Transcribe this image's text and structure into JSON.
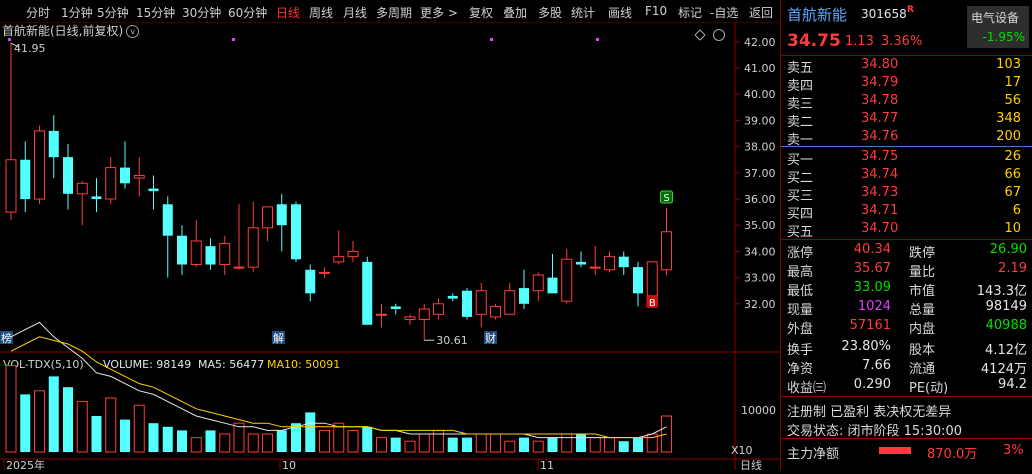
{
  "toolbar": {
    "items": [
      "分时",
      "1分钟",
      "5分钟",
      "15分钟",
      "30分钟",
      "60分钟",
      "日线",
      "周线",
      "月线",
      "多周期",
      "更多 >",
      "复权",
      "叠加",
      "多股",
      "统计",
      "画线",
      "F10",
      "标记",
      "-自选",
      "返回"
    ],
    "active_index": 6
  },
  "chart": {
    "title": "首航新能(日线,前复权)",
    "high_label": "41.95",
    "low_label": "30.61",
    "price_axis": [
      "42.00",
      "41.00",
      "40.00",
      "39.00",
      "38.00",
      "37.00",
      "36.00",
      "35.00",
      "34.00",
      "33.00",
      "32.00"
    ],
    "marker_s": "S",
    "marker_b": "B",
    "event_labels": [
      "榜",
      "解",
      "财"
    ],
    "vol_indicator": {
      "name": "VOL-TDX(5,10)",
      "volume_label": "VOLUME: 98149",
      "ma5_label": "MA5: 56477",
      "ma10_label": "MA10: 50091"
    },
    "vol_axis": [
      "10000",
      "X10"
    ],
    "date_labels": [
      "2025年",
      "10",
      "11"
    ],
    "period_label": "日线"
  },
  "chart_data": {
    "type": "candlestick",
    "title": "首航新能(日线,前复权)",
    "ylim": [
      31.0,
      42.3
    ],
    "candles": [
      {
        "o": 35.5,
        "h": 41.95,
        "l": 35.2,
        "c": 37.5
      },
      {
        "o": 37.5,
        "h": 38.2,
        "l": 35.5,
        "c": 36.0
      },
      {
        "o": 36.0,
        "h": 38.8,
        "l": 35.8,
        "c": 38.6
      },
      {
        "o": 38.6,
        "h": 39.2,
        "l": 36.8,
        "c": 37.6
      },
      {
        "o": 37.6,
        "h": 38.1,
        "l": 35.6,
        "c": 36.2
      },
      {
        "o": 36.2,
        "h": 36.7,
        "l": 35.0,
        "c": 36.6
      },
      {
        "o": 36.1,
        "h": 36.8,
        "l": 35.5,
        "c": 36.0
      },
      {
        "o": 36.0,
        "h": 37.6,
        "l": 35.8,
        "c": 37.2
      },
      {
        "o": 37.2,
        "h": 38.2,
        "l": 36.4,
        "c": 36.6
      },
      {
        "o": 36.8,
        "h": 37.6,
        "l": 36.1,
        "c": 36.9
      },
      {
        "o": 36.4,
        "h": 36.9,
        "l": 35.6,
        "c": 36.3
      },
      {
        "o": 35.8,
        "h": 36.1,
        "l": 33.0,
        "c": 34.6
      },
      {
        "o": 34.6,
        "h": 35.0,
        "l": 33.1,
        "c": 33.5
      },
      {
        "o": 33.5,
        "h": 35.2,
        "l": 33.4,
        "c": 34.4
      },
      {
        "o": 34.2,
        "h": 34.5,
        "l": 33.3,
        "c": 33.5
      },
      {
        "o": 33.5,
        "h": 34.6,
        "l": 33.1,
        "c": 34.3
      },
      {
        "o": 33.4,
        "h": 35.8,
        "l": 33.3,
        "c": 33.4
      },
      {
        "o": 33.4,
        "h": 35.9,
        "l": 33.2,
        "c": 34.9
      },
      {
        "o": 34.9,
        "h": 35.5,
        "l": 34.4,
        "c": 35.7
      },
      {
        "o": 35.8,
        "h": 36.2,
        "l": 34.0,
        "c": 35.0
      },
      {
        "o": 35.8,
        "h": 35.9,
        "l": 33.6,
        "c": 33.7
      },
      {
        "o": 33.3,
        "h": 33.5,
        "l": 32.1,
        "c": 32.4
      },
      {
        "o": 33.2,
        "h": 33.4,
        "l": 33.0,
        "c": 33.2
      },
      {
        "o": 33.6,
        "h": 34.8,
        "l": 33.5,
        "c": 33.8
      },
      {
        "o": 33.8,
        "h": 34.4,
        "l": 33.6,
        "c": 34.0
      },
      {
        "o": 33.6,
        "h": 33.8,
        "l": 31.2,
        "c": 31.2
      },
      {
        "o": 31.6,
        "h": 32.0,
        "l": 31.1,
        "c": 31.6
      },
      {
        "o": 31.9,
        "h": 32.0,
        "l": 31.6,
        "c": 31.8
      },
      {
        "o": 31.4,
        "h": 31.6,
        "l": 31.2,
        "c": 31.5
      },
      {
        "o": 31.4,
        "h": 32.0,
        "l": 30.61,
        "c": 31.8
      },
      {
        "o": 31.6,
        "h": 32.2,
        "l": 31.4,
        "c": 32.0
      },
      {
        "o": 32.3,
        "h": 32.4,
        "l": 32.1,
        "c": 32.2
      },
      {
        "o": 32.5,
        "h": 32.6,
        "l": 31.4,
        "c": 31.5
      },
      {
        "o": 31.6,
        "h": 32.8,
        "l": 31.1,
        "c": 32.5
      },
      {
        "o": 31.5,
        "h": 32.0,
        "l": 31.4,
        "c": 31.9
      },
      {
        "o": 31.6,
        "h": 32.8,
        "l": 31.6,
        "c": 32.5
      },
      {
        "o": 32.6,
        "h": 33.3,
        "l": 31.8,
        "c": 32.0
      },
      {
        "o": 32.5,
        "h": 33.2,
        "l": 32.1,
        "c": 33.1
      },
      {
        "o": 33.0,
        "h": 33.9,
        "l": 32.7,
        "c": 32.4
      },
      {
        "o": 32.1,
        "h": 34.1,
        "l": 32.0,
        "c": 33.7
      },
      {
        "o": 33.6,
        "h": 34.0,
        "l": 33.4,
        "c": 33.5
      },
      {
        "o": 33.4,
        "h": 34.2,
        "l": 33.1,
        "c": 33.4
      },
      {
        "o": 33.3,
        "h": 34.0,
        "l": 33.2,
        "c": 33.8
      },
      {
        "o": 33.8,
        "h": 34.0,
        "l": 33.1,
        "c": 33.4
      },
      {
        "o": 33.4,
        "h": 33.6,
        "l": 31.9,
        "c": 32.4
      },
      {
        "o": 32.3,
        "h": 33.4,
        "l": 32.2,
        "c": 33.6
      },
      {
        "o": 33.3,
        "h": 35.67,
        "l": 33.09,
        "c": 34.75
      }
    ],
    "volumes": [
      24,
      16,
      17,
      21,
      18,
      14,
      10,
      15,
      9,
      13,
      8,
      7,
      6,
      4,
      6,
      5,
      8,
      5,
      5,
      6,
      8,
      11,
      6,
      8,
      6,
      7,
      4,
      4,
      3,
      5,
      6,
      4,
      4,
      5,
      5,
      3,
      4,
      3,
      4,
      5,
      5,
      4,
      4,
      3,
      4,
      5,
      10
    ],
    "ma5": [
      32,
      34,
      36,
      32,
      29,
      26,
      22,
      21,
      19,
      17,
      16,
      14,
      12,
      10,
      9,
      8,
      7,
      7,
      6,
      6,
      7,
      8,
      8,
      7,
      7,
      7,
      6,
      6,
      5,
      5,
      5,
      5,
      5,
      5,
      5,
      5,
      5,
      4,
      4,
      4,
      4,
      4,
      4,
      4,
      4,
      5,
      7
    ],
    "ma10": [
      28,
      30,
      32,
      31,
      30,
      28,
      25,
      23,
      21,
      19,
      18,
      16,
      14,
      12,
      11,
      10,
      9,
      8,
      8,
      7,
      7,
      7,
      7,
      7,
      7,
      7,
      6,
      6,
      6,
      6,
      6,
      6,
      5,
      5,
      5,
      5,
      5,
      5,
      5,
      5,
      5,
      5,
      4,
      4,
      4,
      4,
      5
    ]
  },
  "stock": {
    "name": "首航新能",
    "code": "301658",
    "r_badge": "R",
    "sector": "电气设备",
    "sector_change": "-1.95%",
    "price": "34.75",
    "change": "1.13",
    "change_pct": "3.36%"
  },
  "sell_orders": [
    {
      "label": "卖五",
      "price": "34.80",
      "vol": "103"
    },
    {
      "label": "卖四",
      "price": "34.79",
      "vol": "17"
    },
    {
      "label": "卖三",
      "price": "34.78",
      "vol": "56"
    },
    {
      "label": "卖二",
      "price": "34.77",
      "vol": "348"
    },
    {
      "label": "卖一",
      "price": "34.76",
      "vol": "200"
    }
  ],
  "buy_orders": [
    {
      "label": "买一",
      "price": "34.75",
      "vol": "26"
    },
    {
      "label": "买二",
      "price": "34.74",
      "vol": "66"
    },
    {
      "label": "买三",
      "price": "34.73",
      "vol": "67"
    },
    {
      "label": "买四",
      "price": "34.71",
      "vol": "6"
    },
    {
      "label": "买五",
      "price": "34.70",
      "vol": "10"
    }
  ],
  "stats": {
    "zhangting_l": "涨停",
    "zhangting": "40.34",
    "dieting_l": "跌停",
    "dieting": "26.90",
    "zuigao_l": "最高",
    "zuigao": "35.67",
    "liangbi_l": "量比",
    "liangbi": "2.19",
    "zuidi_l": "最低",
    "zuidi": "33.09",
    "shizhi_l": "市值",
    "shizhi": "143.3亿",
    "xianliang_l": "现量",
    "xianliang": "1024",
    "zongliang_l": "总量",
    "zongliang": "98149",
    "waipan_l": "外盘",
    "waipan": "57161",
    "neipan_l": "内盘",
    "neipan": "40988",
    "huanshou_l": "换手",
    "huanshou": "23.80%",
    "guben_l": "股本",
    "guben": "4.12亿",
    "jingzi_l": "净资",
    "jingzi": "7.66",
    "liutong_l": "流通",
    "liutong": "4124万",
    "shouyi_l": "收益㈢",
    "shouyi": "0.290",
    "pe_l": "PE(动)",
    "pe": "94.2"
  },
  "info": {
    "line1": "注册制 已盈利 表决权无差异",
    "line2": "交易状态: 闭市阶段 15:30:00"
  },
  "flow": {
    "label": "主力净额",
    "value": "870.0万",
    "pct": "3%"
  },
  "colors": {
    "up": "#ff3b3b",
    "down": "#54ffff",
    "bg": "#000000",
    "grid": "#8b0000"
  }
}
